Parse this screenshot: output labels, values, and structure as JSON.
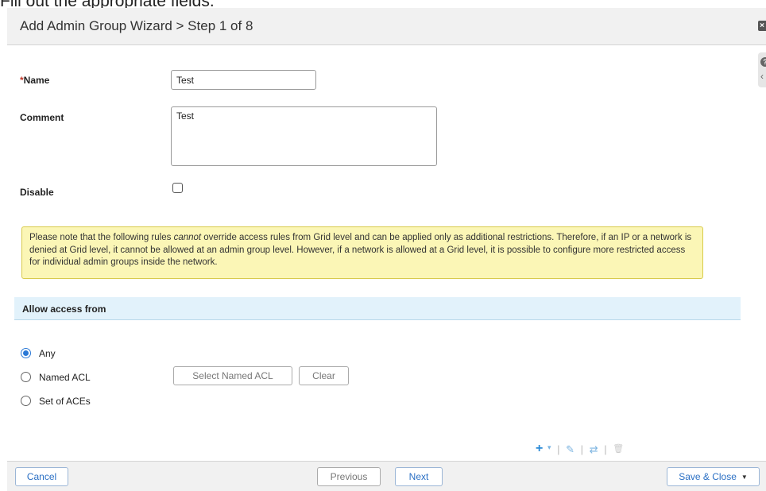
{
  "caption": "Fill out the appropriate fields.",
  "dialog": {
    "title": "Add Admin Group Wizard > Step 1 of 8",
    "close_glyph": "×",
    "help_glyph": "?",
    "collapse_glyph": "‹"
  },
  "form": {
    "name_required_mark": "*",
    "name_label": "Name",
    "name_value": "Test",
    "comment_label": "Comment",
    "comment_value": "Test",
    "disable_label": "Disable",
    "disable_checked": false
  },
  "note": {
    "before_emphasis": "Please note that the following rules ",
    "emphasis": "cannot",
    "after_emphasis": " override access rules from Grid level and can be applied only as additional restrictions. Therefore, if an IP or a network is denied at Grid level, it cannot be allowed at an admin group level. However, if a network is allowed at a Grid level, it is possible to configure more restricted access for individual admin groups inside the network."
  },
  "access": {
    "section_title": "Allow access from",
    "options": [
      {
        "label": "Any",
        "checked": true
      },
      {
        "label": "Named ACL",
        "checked": false
      },
      {
        "label": "Set of ACEs",
        "checked": false
      }
    ],
    "select_named_acl_label": "Select Named ACL",
    "clear_label": "Clear"
  },
  "toolbar": {
    "icons": [
      "add-icon",
      "dropdown-caret-icon",
      "edit-icon",
      "swap-icon",
      "delete-icon"
    ],
    "add_glyph": "+",
    "caret_glyph": "▾",
    "edit_glyph": "✎",
    "swap_glyph": "⇄",
    "delete_glyph": "🗑",
    "separator": "|"
  },
  "footer": {
    "cancel_label": "Cancel",
    "previous_label": "Previous",
    "next_label": "Next",
    "save_close_label": "Save & Close",
    "save_caret": "▼"
  },
  "colors": {
    "primary_blue": "#2a78d6",
    "note_bg": "#fbf6b6",
    "section_bg": "#e2f2fb",
    "required_red": "#c0392b"
  }
}
